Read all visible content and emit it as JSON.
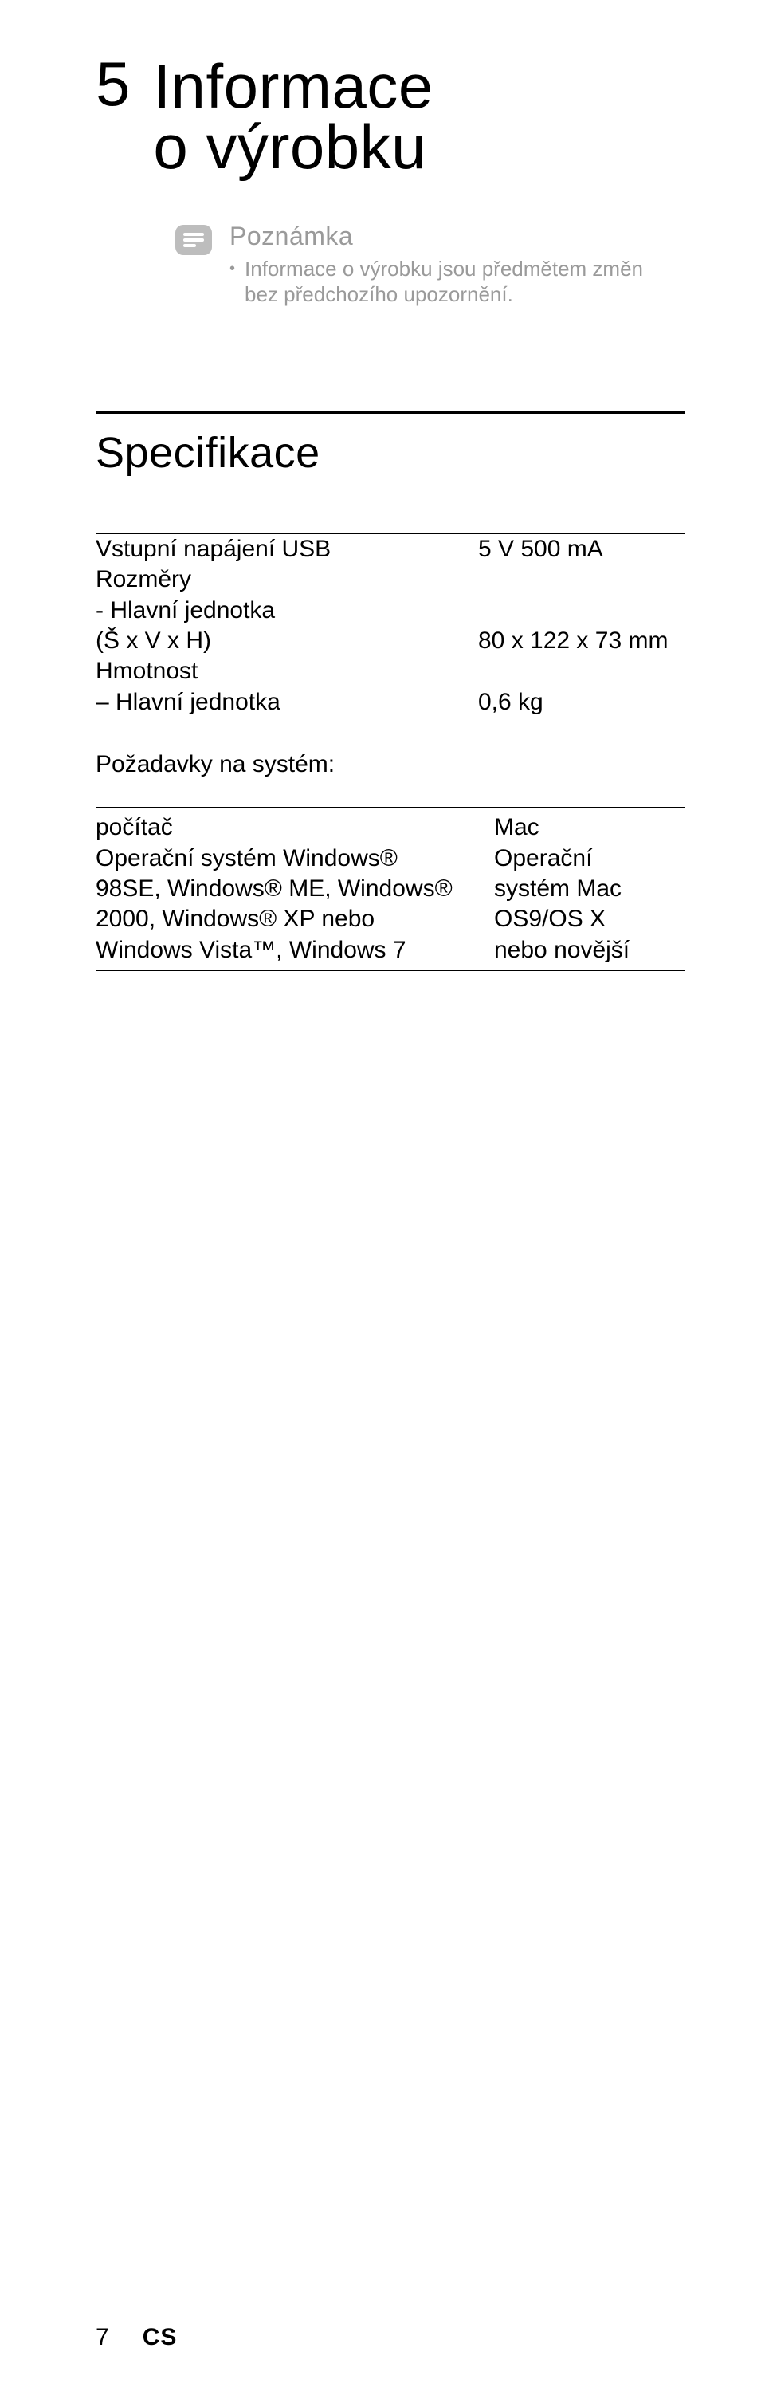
{
  "chapter": {
    "number": "5",
    "title_line1": "Informace",
    "title_line2": "o výrobku"
  },
  "note": {
    "label": "Poznámka",
    "text": "Informace o výrobku jsou předmětem změn bez předchozího upozornění."
  },
  "spec": {
    "heading": "Specifikace",
    "rows": {
      "r1_left": "Vstupní napájení USB",
      "r1_right": "5 V  500 mA",
      "r2_left": "Rozměry",
      "r3_left": "- Hlavní jednotka",
      "r4_left": "(Š x V x H)",
      "r4_right": "80 x 122 x 73 mm",
      "r5_left": "Hmotnost",
      "r6_left": "– Hlavní jednotka",
      "r6_right": "0,6 kg"
    },
    "req_label": "Požadavky na systém:",
    "req": {
      "pc_head": "počítač",
      "mac_head": "Mac",
      "pc_line1": "Operační systém Windows®",
      "pc_line2": "98SE, Windows® ME, Windows®",
      "pc_line3": "2000, Windows® XP nebo",
      "pc_line4": "Windows Vista™, Windows 7",
      "mac_line1": "Operační",
      "mac_line2": "systém Mac",
      "mac_line3": "OS9/OS X",
      "mac_line4": "nebo novější"
    }
  },
  "footer": {
    "page": "7",
    "lang": "CS"
  }
}
